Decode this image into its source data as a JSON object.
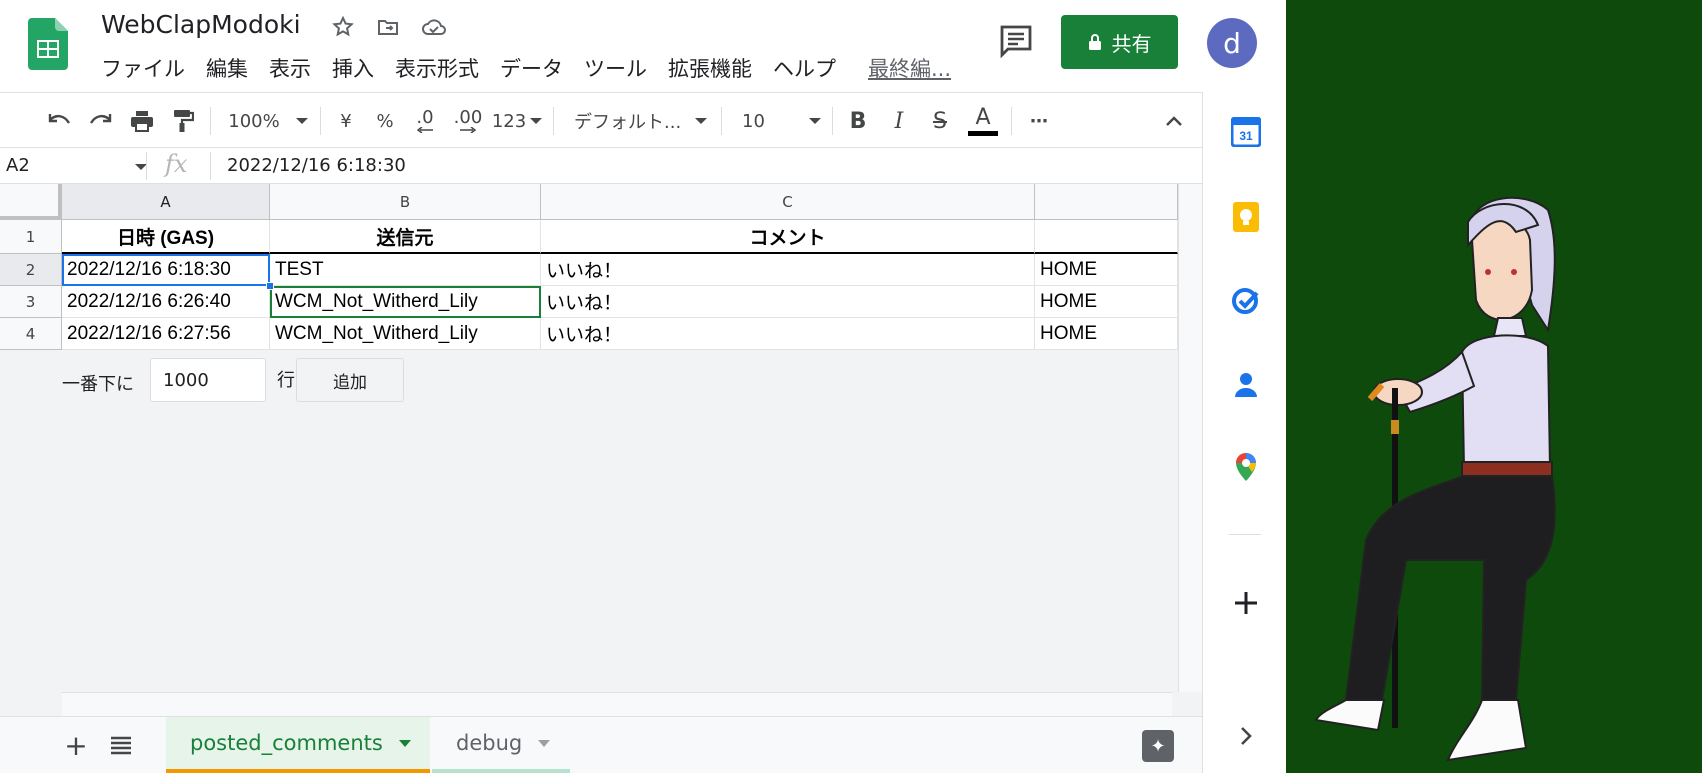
{
  "document": {
    "title": "WebClapModoki",
    "menu": [
      "ファイル",
      "編集",
      "表示",
      "挿入",
      "表示形式",
      "データ",
      "ツール",
      "拡張機能",
      "ヘルプ"
    ],
    "last_edit": "最終編...",
    "share_label": "共有",
    "avatar_letter": "d"
  },
  "toolbar": {
    "zoom": "100%",
    "currency": "¥",
    "percent": "%",
    "dec_decrease": ".0",
    "dec_increase": ".00",
    "number_format": "123",
    "font": "デフォルト...",
    "font_size": "10",
    "bold": "B",
    "italic": "I",
    "strikethrough": "S",
    "text_color": "A",
    "more": "⋯"
  },
  "formula_bar": {
    "cell_ref": "A2",
    "fx": "fx",
    "value": "2022/12/16 6:18:30"
  },
  "grid": {
    "columns": [
      "A",
      "B",
      "C"
    ],
    "rows": [
      "1",
      "2",
      "3",
      "4"
    ],
    "header": [
      "日時 (GAS)",
      "送信元",
      "コメント",
      ""
    ],
    "data": [
      [
        "2022/12/16 6:18:30",
        "TEST",
        "いいね！",
        "HOME"
      ],
      [
        "2022/12/16 6:26:40",
        "WCM_Not_Witherd_Lily",
        "いいね！",
        "HOME"
      ],
      [
        "2022/12/16 6:27:56",
        "WCM_Not_Witherd_Lily",
        "いいね！",
        "HOME"
      ]
    ]
  },
  "add_rows": {
    "prefix": "一番下に",
    "count": "1000",
    "suffix": "行",
    "button": "追加"
  },
  "sheet_tabs": {
    "tabs": [
      "posted_comments",
      "debug"
    ],
    "active": "posted_comments"
  },
  "side_panel": {
    "calendar_day": "31"
  },
  "colors": {
    "sheets_green": "#188038",
    "selection_blue": "#1a73e8",
    "wallpaper_green": "#0f4a0d",
    "active_tab_underline": "#f29900"
  }
}
